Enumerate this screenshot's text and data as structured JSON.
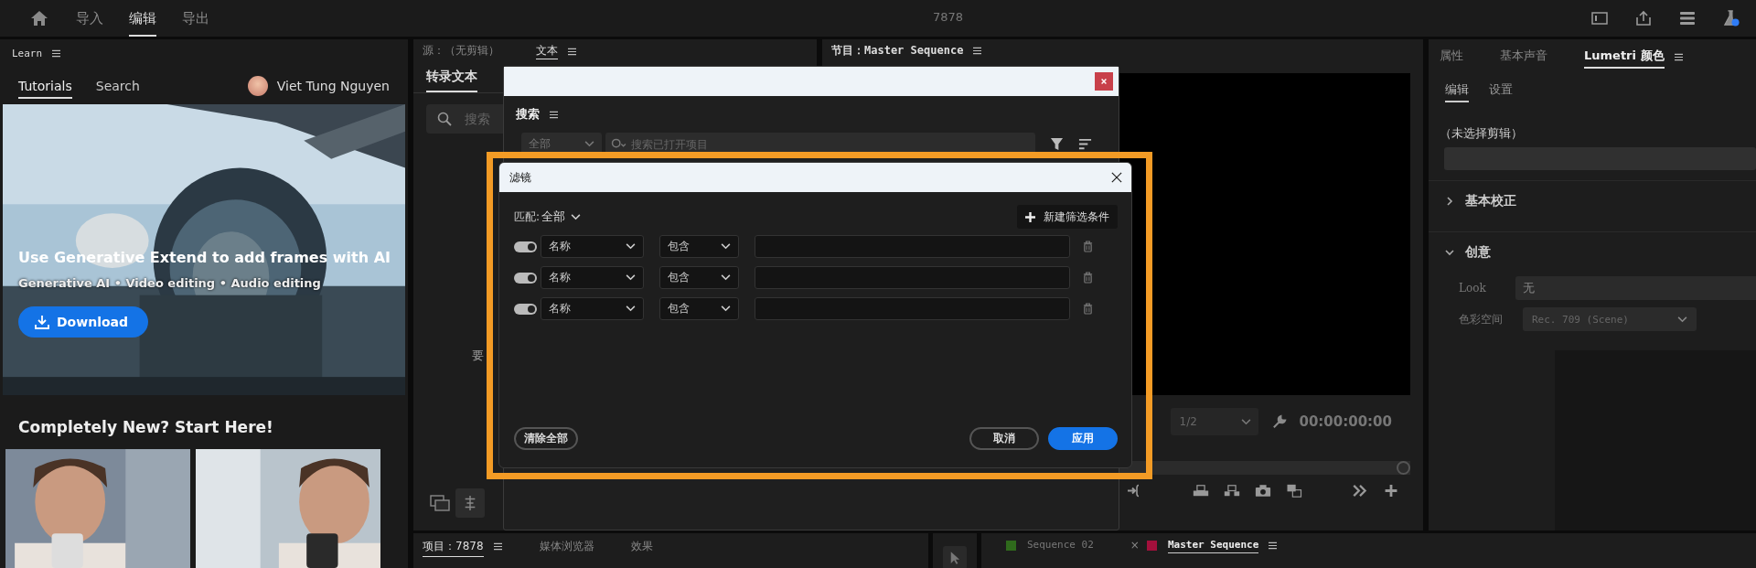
{
  "top_bar": {
    "tabs": [
      {
        "label": "导入",
        "selected": false
      },
      {
        "label": "编辑",
        "selected": true
      },
      {
        "label": "导出",
        "selected": false
      }
    ],
    "title": "7878"
  },
  "learn_panel": {
    "title": "Learn",
    "tabs": [
      {
        "label": "Tutorials",
        "selected": true
      },
      {
        "label": "Search",
        "selected": false
      }
    ],
    "user_name": "Viet Tung Nguyen",
    "hero": {
      "kind": "picture",
      "headline": "Use Generative Extend to add frames with AI",
      "tags": "Generative AI • Video editing • Audio editing",
      "button": "Download"
    },
    "section_title": "Completely New? Start Here!"
  },
  "source_panel": {
    "tabs": [
      {
        "label": "源：（无剪辑）",
        "selected": false
      },
      {
        "label": "文本",
        "selected": true
      }
    ],
    "subtab": "转录文本",
    "search_placeholder": "搜索",
    "hint": "要"
  },
  "program_panel": {
    "title": "节目：Master Sequence",
    "resolution": "1/2",
    "timecode": "00:00:00:00"
  },
  "lumetri_panel": {
    "tabs": [
      {
        "label": "属性",
        "selected": false
      },
      {
        "label": "基本声音",
        "selected": false
      },
      {
        "label": "Lumetri 颜色",
        "selected": true
      }
    ],
    "subtabs": [
      {
        "label": "编辑",
        "selected": true
      },
      {
        "label": "设置",
        "selected": false
      }
    ],
    "clip_status": "（未选择剪辑）",
    "sections": [
      {
        "title": "基本校正",
        "expanded": false
      },
      {
        "title": "创意",
        "expanded": true
      }
    ],
    "look": {
      "label": "Look",
      "value": "无"
    },
    "color_space": {
      "label": "色彩空间",
      "value": "Rec. 709 (Scene)"
    }
  },
  "project_tabs": [
    {
      "label": "项目：7878",
      "selected": true
    },
    {
      "label": "媒体浏览器",
      "selected": false
    },
    {
      "label": "效果",
      "selected": false
    }
  ],
  "timeline_tabs": [
    {
      "label": "Sequence 02",
      "selected": false,
      "color": "#2f6a1c"
    },
    {
      "label": "Master Sequence",
      "selected": true,
      "color": "#a3103c",
      "close": "×"
    }
  ],
  "search_dialog": {
    "title": "搜索",
    "scope": "全部",
    "placeholder": "搜索已打开项目"
  },
  "filter_dialog": {
    "title": "滤镜",
    "match_label": "匹配:",
    "match_value": "全部",
    "add_button": "新建筛选条件",
    "rows": [
      {
        "on": true,
        "field": "名称",
        "operator": "包含"
      },
      {
        "on": true,
        "field": "名称",
        "operator": "包含"
      },
      {
        "on": true,
        "field": "名称",
        "operator": "包含"
      }
    ],
    "clear_button": "清除全部",
    "cancel_button": "取消",
    "apply_button": "应用"
  }
}
